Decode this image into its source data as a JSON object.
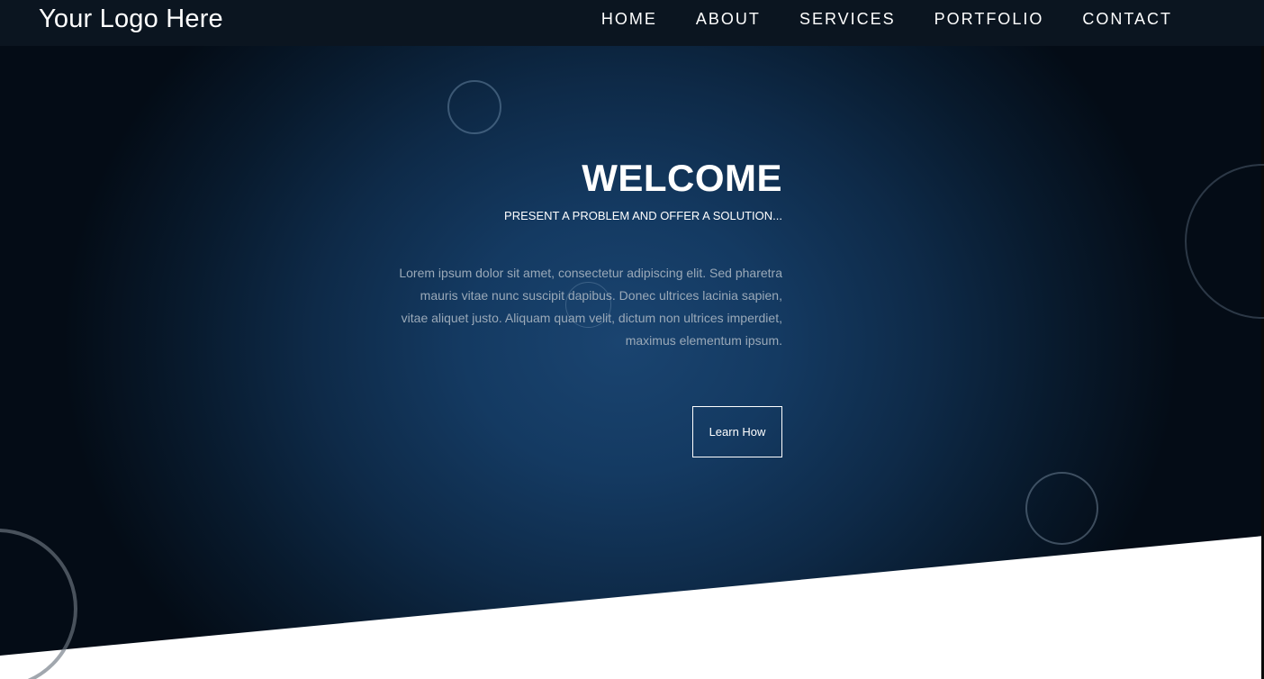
{
  "header": {
    "logo": "Your Logo Here",
    "nav": [
      "HOME",
      "ABOUT",
      "SERVICES",
      "PORTFOLIO",
      "CONTACT"
    ]
  },
  "hero": {
    "title": "WELCOME",
    "subtitle": "PRESENT A PROBLEM AND OFFER A SOLUTION...",
    "body": "Lorem ipsum dolor sit amet, consectetur adipiscing elit. Sed pharetra mauris vitae nunc suscipit dapibus. Donec ultrices lacinia sapien, vitae aliquet justo. Aliquam quam velit, dictum non ultrices imperdiet, maximus elementum ipsum.",
    "button_label": "Learn How"
  },
  "colors": {
    "hero_center": "#1a4470",
    "hero_edge": "#040c16",
    "navbar": "#0b1520",
    "text": "#ffffff",
    "body_text": "#9aa9b8"
  }
}
